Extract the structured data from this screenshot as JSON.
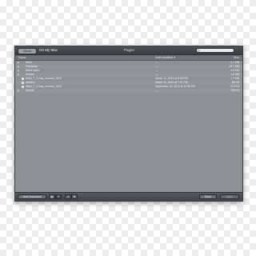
{
  "titlebar": {
    "icloud_label": "iCloud",
    "location": "On My Mac",
    "document_title": "Pages",
    "search_placeholder": ""
  },
  "columns": {
    "name": "Name",
    "date_modified": "Date Modified",
    "size": "Size"
  },
  "rows": [
    {
      "type": "folder",
      "name": "Work",
      "date": "—",
      "size": "4.1 MB"
    },
    {
      "type": "folder",
      "name": "Freelance",
      "date": "—",
      "size": "19.7 MB"
    },
    {
      "type": "folder",
      "name": "Band notes",
      "date": "—",
      "size": "4.6 MB"
    },
    {
      "type": "folder",
      "name": "Stories",
      "date": "—",
      "size": "1.6 MB"
    },
    {
      "type": "file",
      "name": "Mark_T_Comp_resume_2012",
      "date": "March 11, 2013 at 8:05 PM",
      "size": "1.7 MB"
    },
    {
      "type": "file",
      "name": "stickers",
      "date": "March 11, 2013 at 7:07 PM",
      "size": "86 KB"
    },
    {
      "type": "file",
      "name": "Mark_T_Comp_resume_2012",
      "date": "September 14, 2012 at 12:08 PM",
      "size": "273 KB"
    },
    {
      "type": "folder",
      "name": "Novels",
      "date": "—",
      "size": "799 KB"
    }
  ],
  "bottombar": {
    "new_document": "New Document",
    "done": "Done",
    "open": "Open"
  },
  "colors": {
    "window_bg": "#8d9196",
    "titlebar_bg": "#45484c",
    "header_bg": "#6f7378"
  }
}
